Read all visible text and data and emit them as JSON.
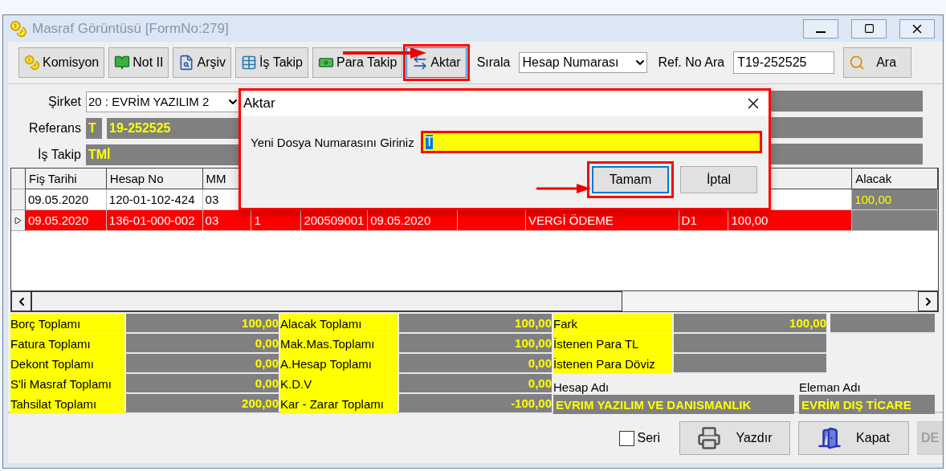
{
  "window": {
    "title": "Masraf Görüntüsü [FormNo:279]"
  },
  "toolbar": {
    "buttons": [
      {
        "label": "Komisyon",
        "highlighted": false
      },
      {
        "label": "Not II",
        "highlighted": false
      },
      {
        "label": "Arşiv",
        "highlighted": false
      },
      {
        "label": "İş Takip",
        "highlighted": false
      },
      {
        "label": "Para Takip",
        "highlighted": false
      },
      {
        "label": "Aktar",
        "highlighted": true
      }
    ],
    "sort_label": "Sırala",
    "sort_value": "Hesap Numarası",
    "search_label": "Ref. No Ara",
    "search_value": "T19-252525",
    "search_button": "Ara"
  },
  "form": {
    "fields": [
      {
        "label": "Şirket",
        "kind": "combo",
        "value": "20 : EVRİM YAZILIM  2"
      },
      {
        "label": "Referans",
        "kind": "split",
        "prefix": "T",
        "value": "19-252525"
      },
      {
        "label": "İş Takip",
        "kind": "text",
        "value": "TMİ"
      }
    ]
  },
  "grid": {
    "columns": [
      {
        "label": "Fiş Tarihi",
        "shaded": false
      },
      {
        "label": "Hesap No",
        "shaded": false
      },
      {
        "label": "MM",
        "shaded": false
      },
      {
        "shaded": false
      },
      {
        "shaded": false
      },
      {
        "shaded": false
      },
      {
        "shaded": false
      },
      {
        "shaded": false
      },
      {
        "shaded": false
      },
      {
        "shaded": false
      },
      {
        "label": "Alacak",
        "shaded": true
      }
    ],
    "rows": [
      {
        "selected": false,
        "cells": [
          "09.05.2020",
          "120-01-102-424",
          "03",
          null,
          null,
          null,
          null,
          null,
          null,
          null,
          "100,00"
        ]
      },
      {
        "selected": true,
        "cells": [
          "09.05.2020",
          "136-01-000-002",
          "03",
          "1",
          "200509001",
          "09.05.2020",
          null,
          "VERGİ ÖDEME",
          "D1",
          "100,00",
          null
        ]
      }
    ]
  },
  "totals": {
    "left": [
      {
        "label": "Borç Toplamı",
        "value": "100,00"
      },
      {
        "label": "Fatura Toplamı",
        "value": "0,00"
      },
      {
        "label": "Dekont Toplamı",
        "value": "0,00"
      },
      {
        "label": "S'li Masraf Toplamı",
        "value": "0,00"
      },
      {
        "label": "Tahsilat Toplamı",
        "value": "200,00"
      }
    ],
    "middle": [
      {
        "label": "Alacak Toplamı",
        "value": "100,00"
      },
      {
        "label": "Mak.Mas.Toplamı",
        "value": "100,00"
      },
      {
        "label": "A.Hesap Toplamı",
        "value": "0,00"
      },
      {
        "label": "K.D.V",
        "value": "0,00"
      },
      {
        "label": "Kar - Zarar Toplamı",
        "value": "-100,00"
      }
    ],
    "right": [
      {
        "label": "Fark",
        "value": "100,00"
      },
      {
        "label": "İstenen Para TL"
      },
      {
        "label": "İstenen Para Döviz"
      }
    ],
    "names": [
      {
        "label": "Hesap Adı",
        "value": "EVRIM YAZILIM VE DANISMANLIK"
      },
      {
        "label": "Eleman  Adı",
        "value": "EVRİM DIŞ TİCARE"
      }
    ]
  },
  "footer": {
    "checkbox": {
      "label": "Seri",
      "checked": false
    },
    "buttons": [
      {
        "label": "Yazdır",
        "disabled": false
      },
      {
        "label": "Kapat",
        "disabled": false
      },
      {
        "label": "DE",
        "disabled": true
      }
    ]
  },
  "dialog": {
    "title": "Aktar",
    "highlighted": true,
    "prompt": "Yeni Dosya Numarasını Giriniz",
    "value": "T",
    "value_highlighted": true,
    "buttons": [
      {
        "label": "Tamam",
        "focused": true,
        "highlighted": true
      },
      {
        "label": "İptal",
        "focused": false,
        "highlighted": false
      }
    ]
  }
}
